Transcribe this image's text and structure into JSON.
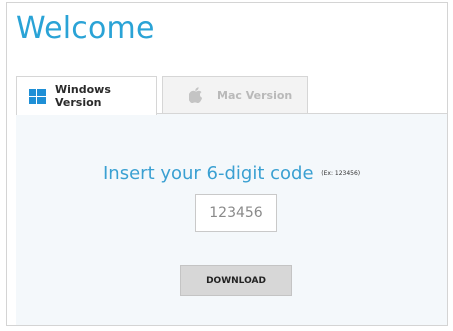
{
  "header": {
    "title": "Welcome"
  },
  "tabs": [
    {
      "label": "Windows Version",
      "icon": "windows-logo-icon",
      "active": true
    },
    {
      "label": "Mac Version",
      "icon": "apple-logo-icon",
      "active": false
    }
  ],
  "form": {
    "prompt": "Insert your 6-digit code",
    "example": "(Ex: 123456)",
    "code_value": "123456",
    "download_label": "DOWNLOAD"
  },
  "colors": {
    "accent": "#2aa3d6",
    "windows_icon": "#1e8fd6",
    "button_bg": "#d7d7d7",
    "panel_bg": "#f4f8fb"
  }
}
